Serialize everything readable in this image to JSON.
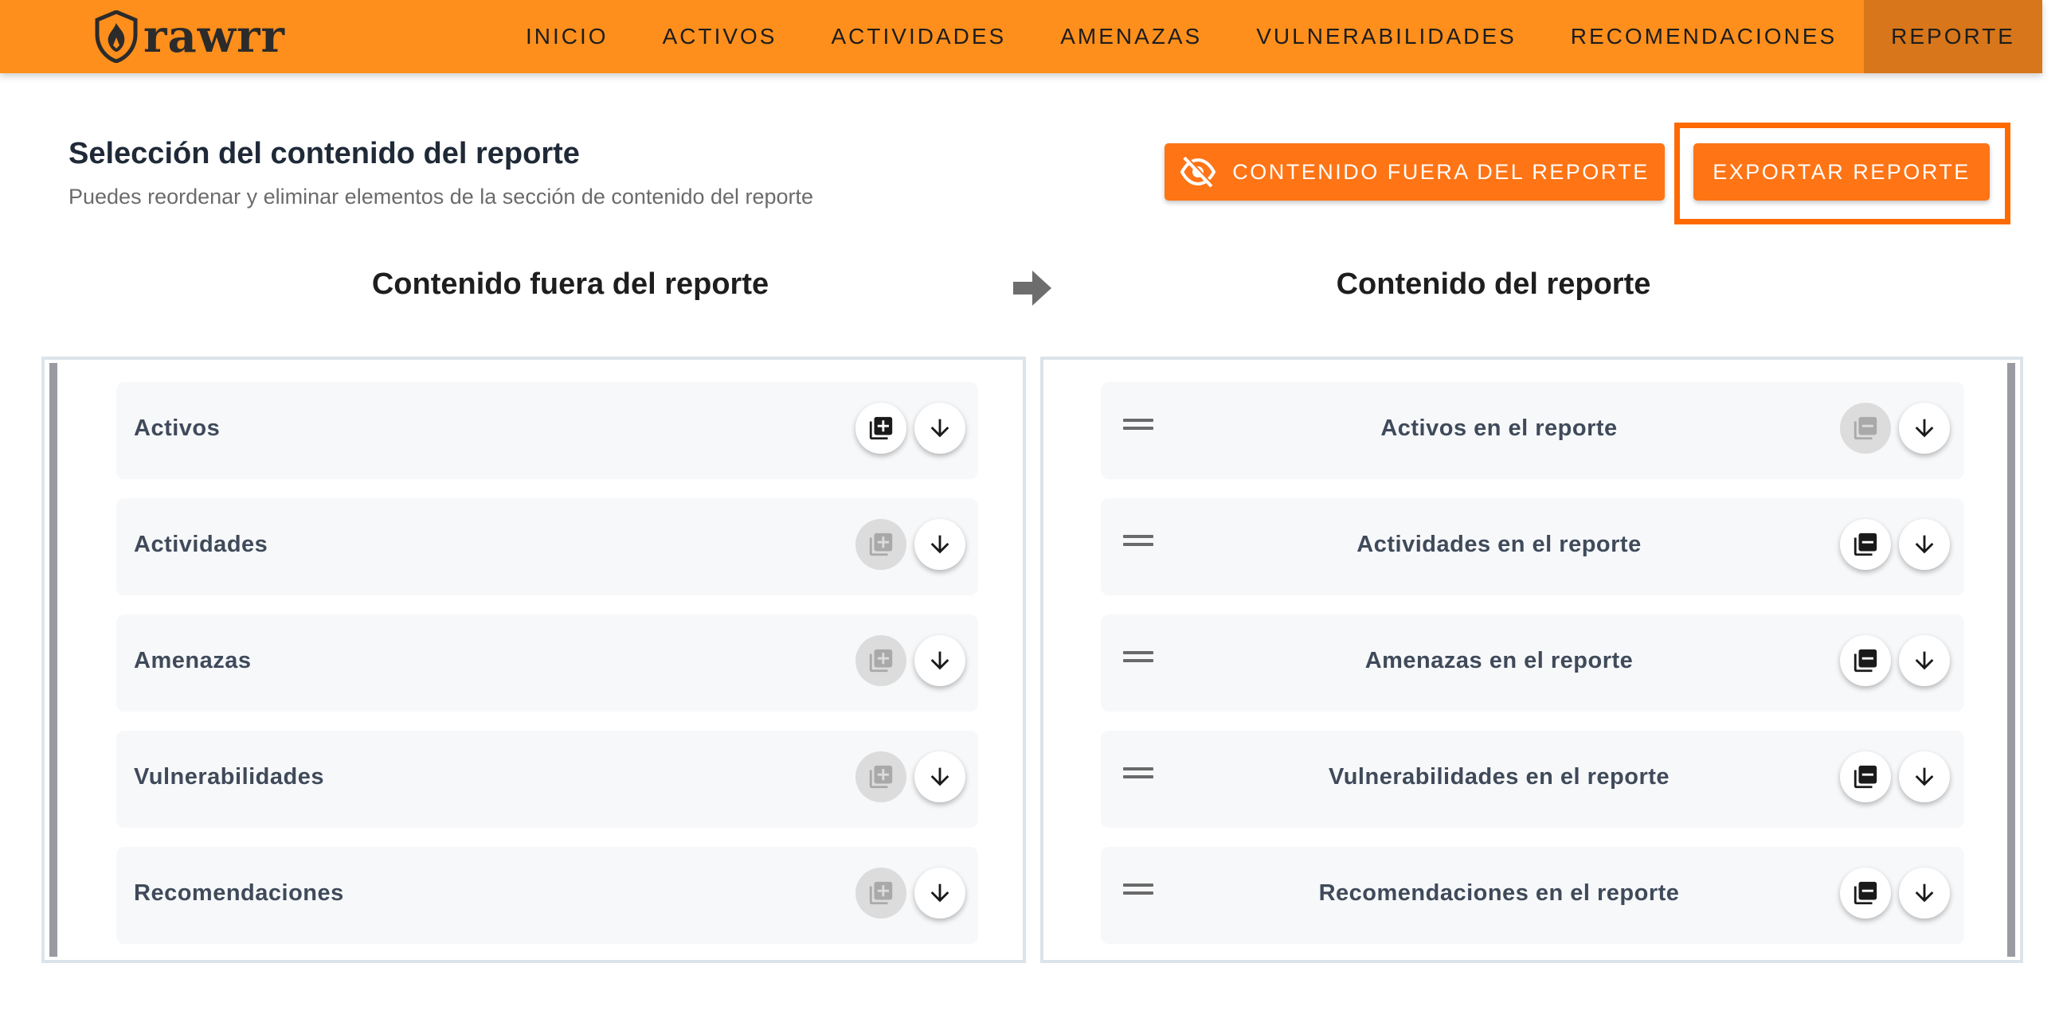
{
  "brand": {
    "name": "rawrr"
  },
  "nav": {
    "items": [
      {
        "label": "INICIO"
      },
      {
        "label": "ACTIVOS"
      },
      {
        "label": "ACTIVIDADES"
      },
      {
        "label": "AMENAZAS"
      },
      {
        "label": "VULNERABILIDADES"
      },
      {
        "label": "RECOMENDACIONES"
      },
      {
        "label": "REPORTE",
        "active": true
      }
    ]
  },
  "header": {
    "title": "Selección del contenido del reporte",
    "subtitle": "Puedes reordenar y eliminar elementos de la sección de contenido del reporte"
  },
  "actions": {
    "hidden_content_label": "CONTENIDO FUERA DEL REPORTE",
    "export_label": "EXPORTAR REPORTE"
  },
  "columns": {
    "outside_title": "Contenido fuera del reporte",
    "inside_title": "Contenido del reporte"
  },
  "outside_items": [
    {
      "label": "Activos",
      "add_enabled": true
    },
    {
      "label": "Actividades",
      "add_enabled": false
    },
    {
      "label": "Amenazas",
      "add_enabled": false
    },
    {
      "label": "Vulnerabilidades",
      "add_enabled": false
    },
    {
      "label": "Recomendaciones",
      "add_enabled": false
    }
  ],
  "inside_items": [
    {
      "label": "Activos en el reporte",
      "remove_enabled": false
    },
    {
      "label": "Actividades en el reporte",
      "remove_enabled": true
    },
    {
      "label": "Amenazas en el reporte",
      "remove_enabled": true
    },
    {
      "label": "Vulnerabilidades en el reporte",
      "remove_enabled": true
    },
    {
      "label": "Recomendaciones en el reporte",
      "remove_enabled": true
    }
  ],
  "colors": {
    "navbar": "#FE8F1C",
    "nav_active": "#D7761A",
    "button": "#FF7415",
    "highlight": "#FF6A00"
  },
  "icons": {
    "logo": "shield-flame-icon",
    "hidden": "eye-off-icon",
    "arrow": "arrow-right-icon",
    "add": "library-add-icon",
    "remove": "library-remove-icon",
    "expand": "arrow-down-icon",
    "drag": "drag-handle-icon"
  }
}
